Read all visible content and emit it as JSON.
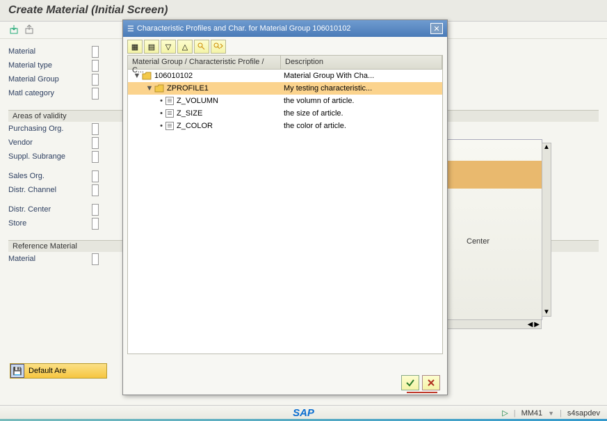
{
  "title": "Create Material (Initial Screen)",
  "form": {
    "material": "Material",
    "material_type": "Material type",
    "material_group": "Material Group",
    "matl_category": "Matl category"
  },
  "areas": {
    "title": "Areas of validity",
    "purchasing_org": "Purchasing Org.",
    "vendor": "Vendor",
    "suppl_subrange": "Suppl. Subrange",
    "sales_org": "Sales Org.",
    "distr_channel": "Distr. Channel",
    "distr_center": "Distr. Center",
    "store": "Store"
  },
  "reference": {
    "title": "Reference Material",
    "material": "Material"
  },
  "right": {
    "center": "Center"
  },
  "default_bar": "Default Are",
  "dialog": {
    "title": "Characteristic Profiles and Char. for Material Group 106010102",
    "cols": {
      "c1": "Material Group / Characteristic Profile / C...",
      "c2": "Description"
    },
    "rows": [
      {
        "indent": 0,
        "toggle": "▼",
        "icon": "folder",
        "label": "106010102",
        "desc": "Material Group With Cha...",
        "sel": false
      },
      {
        "indent": 1,
        "toggle": "▼",
        "icon": "folder",
        "label": "ZPROFILE1",
        "desc": "My testing characteristic...",
        "sel": true
      },
      {
        "indent": 2,
        "toggle": "",
        "icon": "doc",
        "label": "Z_VOLUMN",
        "desc": "the volumn of article.",
        "sel": false
      },
      {
        "indent": 2,
        "toggle": "",
        "icon": "doc",
        "label": "Z_SIZE",
        "desc": "the size of article.",
        "sel": false
      },
      {
        "indent": 2,
        "toggle": "",
        "icon": "doc",
        "label": "Z_COLOR",
        "desc": "the color of article.",
        "sel": false
      }
    ]
  },
  "status": {
    "tcode": "MM41",
    "user": "s4sapdev",
    "logo": "SAP"
  }
}
